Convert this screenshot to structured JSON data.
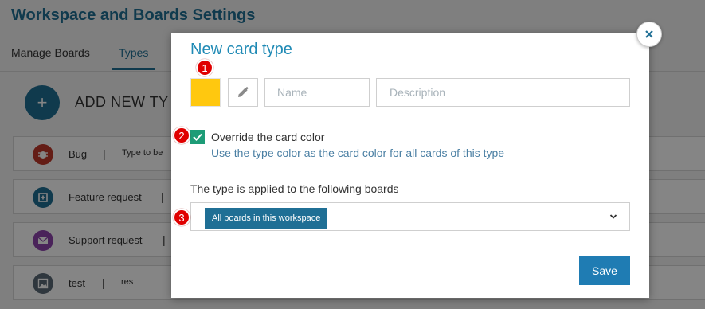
{
  "page": {
    "title": "Workspace and Boards Settings",
    "tabs": [
      {
        "label": "Manage Boards"
      },
      {
        "label": "Types"
      }
    ],
    "add_button_icon": "plus-icon",
    "add_label": "ADD NEW TY",
    "types": [
      {
        "name": "Bug",
        "sep": "|",
        "desc": "Type to be",
        "icon": "bug-icon",
        "color": "#c0392b"
      },
      {
        "name": "Feature request",
        "sep": "|",
        "desc": "",
        "icon": "add-box-icon",
        "color": "#1f6f95"
      },
      {
        "name": "Support request",
        "sep": "|",
        "desc": "",
        "icon": "mail-icon",
        "color": "#8e44ad"
      },
      {
        "name": "test",
        "sep": "|",
        "desc": "res",
        "icon": "image-icon",
        "color": "#5a6a78"
      }
    ]
  },
  "modal": {
    "title": "New card type",
    "close_icon": "close-icon",
    "swatch_color": "#ffc80f",
    "edit_icon": "pencil-icon",
    "name_placeholder": "Name",
    "description_placeholder": "Description",
    "override_checked": true,
    "override_label": "Override the card color",
    "override_hint": "Use the type color as the card color for all cards of this type",
    "boards_label": "The type is applied to the following boards",
    "boards_selected": "All boards in this workspace",
    "boards_chevron": "chevron-down-icon",
    "save_label": "Save"
  },
  "markers": [
    "1",
    "2",
    "3"
  ],
  "colors": {
    "accent": "#1f6f95",
    "title": "#1f8ab5",
    "check": "#1d9c77",
    "marker": "#e00000"
  }
}
